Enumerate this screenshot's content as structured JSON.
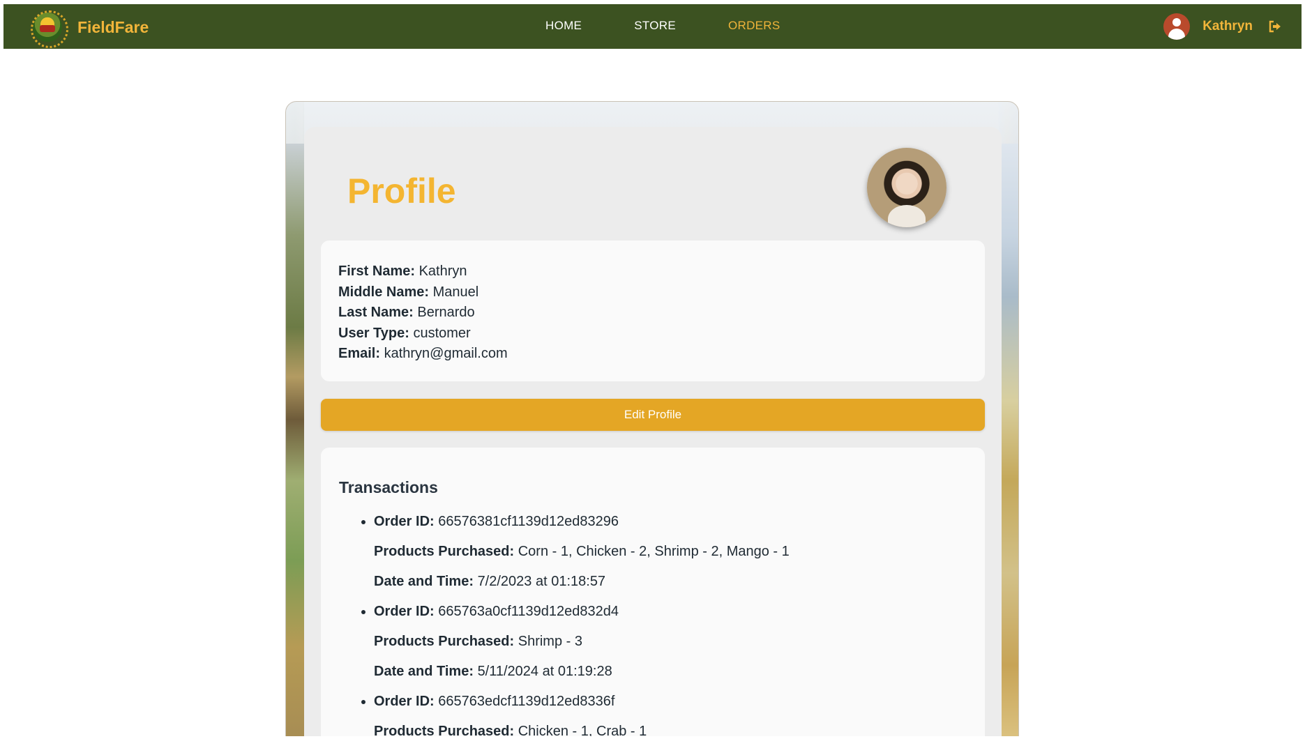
{
  "navbar": {
    "brand": "FieldFare",
    "links": [
      "HOME",
      "STORE",
      "ORDERS"
    ],
    "active_link": "ORDERS",
    "username": "Kathryn",
    "colors": {
      "bar": "#3c5221",
      "accent": "#f2b53a"
    }
  },
  "profile": {
    "title": "Profile",
    "fields": {
      "first_name_label": "First Name:",
      "first_name": "Kathryn",
      "middle_name_label": "Middle Name:",
      "middle_name": "Manuel",
      "last_name_label": "Last Name:",
      "last_name": "Bernardo",
      "user_type_label": "User Type:",
      "user_type": "customer",
      "email_label": "Email:",
      "email": "kathryn@gmail.com"
    },
    "edit_button": "Edit Profile"
  },
  "transactions": {
    "title": "Transactions",
    "order_id_label": "Order ID:",
    "products_label": "Products Purchased:",
    "datetime_label": "Date and Time:",
    "items": [
      {
        "order_id": "66576381cf1139d12ed83296",
        "products": "Corn - 1, Chicken - 2, Shrimp - 2, Mango - 1",
        "datetime": "7/2/2023 at 01:18:57"
      },
      {
        "order_id": "665763a0cf1139d12ed832d4",
        "products": "Shrimp - 3",
        "datetime": "5/11/2024 at 01:19:28"
      },
      {
        "order_id": "665763edcf1139d12ed8336f",
        "products": "Chicken - 1, Crab - 1",
        "datetime": ""
      }
    ]
  }
}
